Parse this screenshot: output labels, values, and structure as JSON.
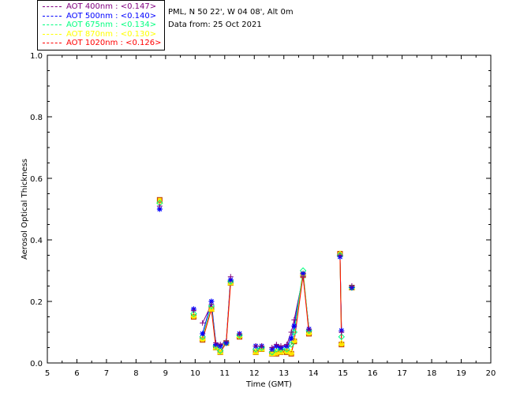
{
  "header": {
    "station": "PML, N 50 22', W 04 08', Alt 0m",
    "date_line": "Data from: 25 Oct 2021"
  },
  "legend": [
    {
      "label": "AOT  400nm : <0.147>",
      "color": "#800080"
    },
    {
      "label": "AOT  500nm : <0.140>",
      "color": "#0000ff"
    },
    {
      "label": "AOT  675nm : <0.134>",
      "color": "#00ff7f"
    },
    {
      "label": "AOT  870nm : <0.130>",
      "color": "#ffff00"
    },
    {
      "label": "AOT 1020nm : <0.126>",
      "color": "#ff0000"
    }
  ],
  "chart_data": {
    "type": "scatter",
    "xlabel": "Time (GMT)",
    "ylabel": "Aerosol Optical Thickness",
    "xlim": [
      5,
      20
    ],
    "ylim": [
      0,
      1.0
    ],
    "x_ticks": [
      "5",
      "6",
      "7",
      "8",
      "9",
      "10",
      "11",
      "12",
      "13",
      "14",
      "15",
      "16",
      "17",
      "18",
      "19",
      "20"
    ],
    "y_ticks": [
      "0.0",
      "0.2",
      "0.4",
      "0.6",
      "0.8",
      "1.0"
    ],
    "series": [
      {
        "name": "AOT  400nm : <0.147>",
        "color": "#800080",
        "marker": "plus",
        "x": [
          8.8,
          9.95,
          10.25,
          10.55,
          10.7,
          10.85,
          11.05,
          11.2,
          11.5,
          12.05,
          12.25,
          12.6,
          12.75,
          12.9,
          13.1,
          13.25,
          13.35,
          13.65,
          13.85,
          14.9,
          14.95,
          15.3
        ],
        "y": [
          0.51,
          0.17,
          0.13,
          0.19,
          0.065,
          0.06,
          0.07,
          0.28,
          0.095,
          0.055,
          0.055,
          0.05,
          0.06,
          0.055,
          0.06,
          0.1,
          0.14,
          0.28,
          0.11,
          0.35,
          0.1,
          0.25
        ]
      },
      {
        "name": "AOT  500nm : <0.140>",
        "color": "#0000ff",
        "marker": "asterisk",
        "x": [
          8.8,
          9.95,
          10.25,
          10.55,
          10.7,
          10.85,
          11.05,
          11.2,
          11.5,
          12.05,
          12.25,
          12.6,
          12.75,
          12.9,
          13.1,
          13.25,
          13.35,
          13.65,
          13.85,
          14.9,
          14.95,
          15.3
        ],
        "y": [
          0.5,
          0.175,
          0.095,
          0.2,
          0.06,
          0.055,
          0.065,
          0.27,
          0.095,
          0.055,
          0.055,
          0.045,
          0.055,
          0.05,
          0.055,
          0.08,
          0.12,
          0.29,
          0.11,
          0.345,
          0.105,
          0.245
        ]
      },
      {
        "name": "AOT  675nm : <0.134>",
        "color": "#00ff7f",
        "marker": "diamond",
        "x": [
          8.8,
          9.95,
          10.25,
          10.55,
          10.7,
          10.85,
          11.05,
          11.2,
          11.5,
          12.05,
          12.25,
          12.6,
          12.75,
          12.9,
          13.1,
          13.25,
          13.35,
          13.65,
          13.85,
          14.9,
          14.95,
          15.3
        ],
        "y": [
          0.52,
          0.16,
          0.085,
          0.185,
          0.055,
          0.04,
          0.065,
          0.265,
          0.09,
          0.045,
          0.05,
          0.035,
          0.045,
          0.045,
          0.045,
          0.06,
          0.1,
          0.3,
          0.105,
          0.35,
          0.085,
          0.245
        ]
      },
      {
        "name": "AOT  870nm : <0.130>",
        "color": "#ffff00",
        "marker": "triangle",
        "x": [
          8.8,
          9.95,
          10.25,
          10.55,
          10.7,
          10.85,
          11.05,
          11.2,
          11.5,
          12.05,
          12.25,
          12.6,
          12.75,
          12.9,
          13.1,
          13.25,
          13.35,
          13.65,
          13.85,
          14.9,
          14.95,
          15.3
        ],
        "y": [
          0.525,
          0.155,
          0.08,
          0.175,
          0.05,
          0.035,
          0.065,
          0.26,
          0.09,
          0.035,
          0.045,
          0.03,
          0.035,
          0.035,
          0.04,
          0.035,
          0.075,
          0.29,
          0.1,
          0.355,
          0.065,
          0.245
        ]
      },
      {
        "name": "AOT 1020nm : <0.126>",
        "color": "#ff0000",
        "marker": "square",
        "x": [
          8.8,
          9.95,
          10.25,
          10.55,
          10.7,
          10.85,
          11.05,
          11.2,
          11.5,
          12.05,
          12.25,
          12.6,
          12.75,
          12.9,
          13.1,
          13.25,
          13.35,
          13.65,
          13.85,
          14.9,
          14.95,
          15.3
        ],
        "y": [
          0.53,
          0.15,
          0.075,
          0.175,
          0.05,
          0.035,
          0.065,
          0.26,
          0.085,
          0.035,
          0.045,
          0.03,
          0.03,
          0.035,
          0.035,
          0.03,
          0.07,
          0.285,
          0.095,
          0.355,
          0.06,
          0.245
        ]
      }
    ],
    "line_segments": [
      [
        2,
        3,
        4,
        5,
        6,
        7
      ],
      [
        9,
        10
      ],
      [
        11,
        12,
        13,
        14,
        15,
        16
      ],
      [
        16,
        17,
        18
      ],
      [
        19,
        20
      ]
    ]
  }
}
